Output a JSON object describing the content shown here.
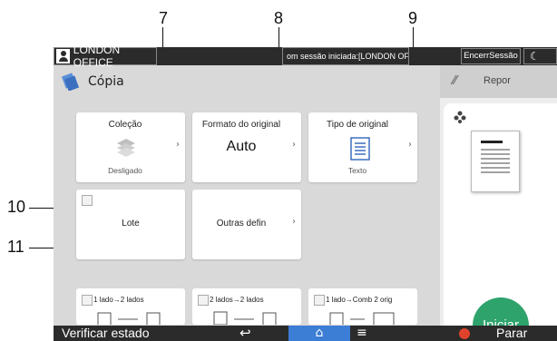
{
  "callouts": [
    "7",
    "8",
    "9",
    "10",
    "11"
  ],
  "topbar": {
    "user_name": "LONDON OFFICE",
    "session_message": "om sessão iniciada:[LONDON OFFIC",
    "logout_label": "EncerrSessão",
    "moon_glyph": "☾"
  },
  "app": {
    "title": "Cópia",
    "icon": "copy-icon"
  },
  "side": {
    "reset_label": "Repor",
    "start_label": "Iniciar"
  },
  "tiles": {
    "collate": {
      "label": "Coleção",
      "value": "Desligado"
    },
    "original_size": {
      "label": "Formato do original",
      "value": "Auto"
    },
    "original_type": {
      "label": "Tipo de original",
      "value": "Texto"
    },
    "batch": {
      "label": "Lote"
    },
    "other_settings": {
      "label": "Outras defin"
    }
  },
  "duplex_options": [
    {
      "label": "1 lado→2 lados"
    },
    {
      "label": "2 lados→2 lados"
    },
    {
      "label": "1 lado→Comb 2 orig"
    }
  ],
  "statusbar": {
    "check_status": "Verificar estado",
    "stop_label": "Parar"
  },
  "colors": {
    "start": "#2fa36c",
    "home": "#3c7dd6",
    "stop": "#e0432c",
    "bar": "#2b2b2b"
  }
}
